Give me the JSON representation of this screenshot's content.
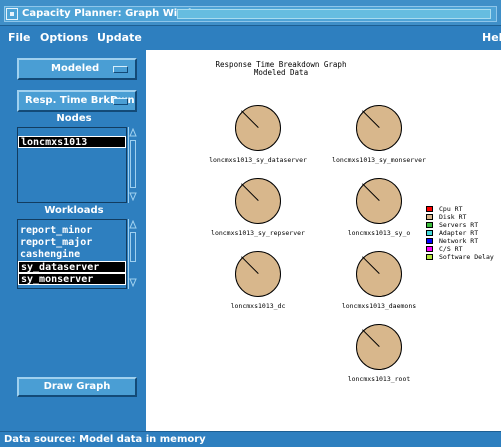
{
  "window": {
    "title": "Capacity Planner: Graph Window"
  },
  "menu": {
    "file": "File",
    "options": "Options",
    "update": "Update",
    "help": "Help"
  },
  "controls": {
    "model_select": "Modeled",
    "graph_type_select": "Resp. Time BrkDwn",
    "nodes_label": "Nodes",
    "nodes": [
      {
        "label": "loncmxs1013",
        "selected": true
      }
    ],
    "workloads_label": "Workloads",
    "workloads": [
      {
        "label": "report_minor",
        "selected": false
      },
      {
        "label": "report_major",
        "selected": false
      },
      {
        "label": "cashengine",
        "selected": false
      },
      {
        "label": "sy_dataserver",
        "selected": true
      },
      {
        "label": "sy_monserver",
        "selected": true
      }
    ],
    "draw_button": "Draw Graph"
  },
  "graph": {
    "title": "Response Time Breakdown Graph",
    "subtitle": "Modeled Data",
    "pies": [
      {
        "label": "loncmxs1013_sy_dataserver"
      },
      {
        "label": "loncmxs1013_sy_monserver"
      },
      {
        "label": "loncmxs1013_sy_repserver"
      },
      {
        "label": "loncmxs1013_sy_o"
      },
      {
        "label": "loncmxs1013_dc"
      },
      {
        "label": "loncmxs1013_daemons"
      },
      {
        "label": "loncmxs1013_root"
      }
    ],
    "legend": [
      {
        "label": "Cpu RT",
        "color": "#ff0000"
      },
      {
        "label": "Disk RT",
        "color": "#d8b78c"
      },
      {
        "label": "Servers RT",
        "color": "#3cbc3c"
      },
      {
        "label": "Adapter RT",
        "color": "#40d8d8"
      },
      {
        "label": "Network RT",
        "color": "#0000ff"
      },
      {
        "label": "C/S RT",
        "color": "#ff00ff"
      },
      {
        "label": "Software Delay",
        "color": "#b4e43c"
      }
    ]
  },
  "status": {
    "text": "Data source: Model data in memory"
  }
}
